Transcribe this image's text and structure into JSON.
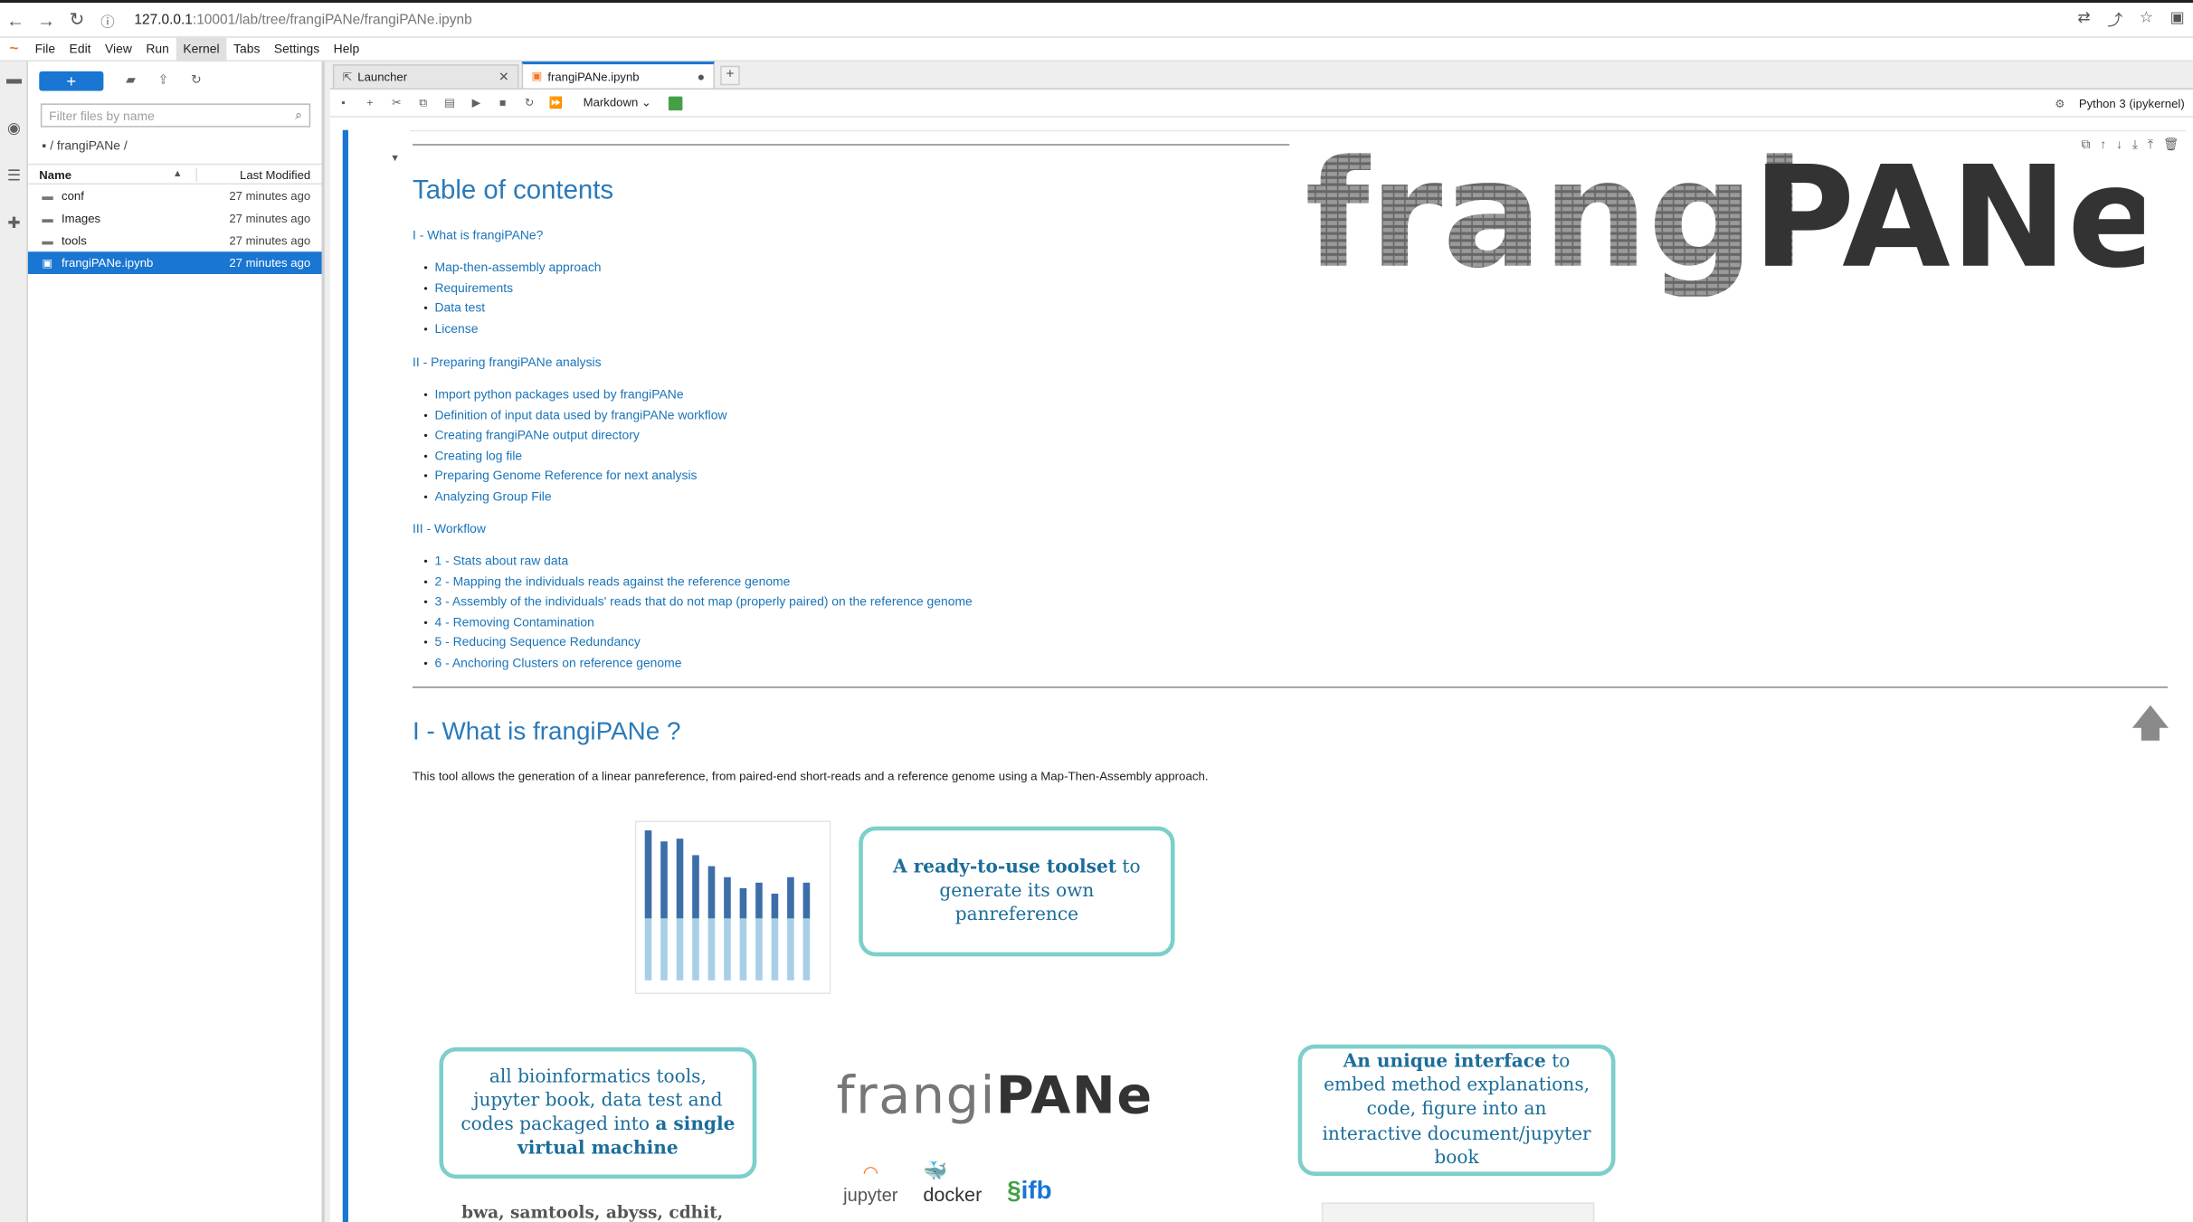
{
  "browser": {
    "url_host": "127.0.0.1",
    "url_path": ":10001/lab/tree/frangiPANe/frangiPANe.ipynb"
  },
  "menu": [
    "File",
    "Edit",
    "View",
    "Run",
    "Kernel",
    "Tabs",
    "Settings",
    "Help"
  ],
  "menu_active": "Kernel",
  "filebrowser": {
    "new_label": "+",
    "search_placeholder": "Filter files by name",
    "breadcrumb": "/ frangiPANe /",
    "col_name": "Name",
    "col_modified": "Last Modified",
    "files": [
      {
        "name": "conf",
        "modified": "27 minutes ago",
        "type": "folder"
      },
      {
        "name": "Images",
        "modified": "27 minutes ago",
        "type": "folder"
      },
      {
        "name": "tools",
        "modified": "27 minutes ago",
        "type": "folder"
      },
      {
        "name": "frangiPANe.ipynb",
        "modified": "27 minutes ago",
        "type": "notebook",
        "selected": true
      }
    ]
  },
  "tabs": [
    {
      "label": "Launcher",
      "active": false
    },
    {
      "label": "frangiPANe.ipynb",
      "active": true
    }
  ],
  "toolbar": {
    "cell_type": "Markdown",
    "kernel": "Python 3 (ipykernel)"
  },
  "notebook": {
    "toc_title": "Table of contents",
    "sections": [
      {
        "title": "I - What is frangiPANe?",
        "items": [
          "Map-then-assembly approach",
          "Requirements",
          "Data test",
          "License"
        ]
      },
      {
        "title": "II - Preparing frangiPANe analysis",
        "items": [
          "Import python packages used by frangiPANe",
          "Definition of input data used by frangiPANe workflow",
          "Creating frangiPANe output directory",
          "Creating log file",
          "Preparing Genome Reference for next analysis",
          "Analyzing Group File"
        ]
      },
      {
        "title": "III - Workflow",
        "items": [
          "1 - Stats about raw data",
          "2 - Mapping the individuals reads against the reference genome",
          "3 - Assembly of the individuals' reads that do not map (properly paired) on the reference genome",
          "4 - Removing Contamination",
          "5 - Reducing Sequence Redundancy",
          "6 - Anchoring Clusters on reference genome"
        ]
      }
    ],
    "heading": "I - What is frangiPANe ?",
    "paragraph": "This tool allows the generation of a linear panreference, from paired-end short-reads and a reference genome using a Map-Then-Assembly approach.",
    "logo_text_left": "frangi",
    "logo_text_right": "PANe",
    "box1": {
      "bold": "A ready-to-use toolset",
      "rest": " to generate its own panreference"
    },
    "box2": {
      "text": "all bioinformatics tools, jupyter book, data test and codes packaged into ",
      "bold": "a single virtual machine"
    },
    "box3": {
      "bold": "An unique interface",
      "rest": " to embed method explanations, code, figure into an interactive document/jupyter book"
    },
    "tools_list": "bwa, samtools, abyss, cdhit,",
    "logos": {
      "jupyter": "jupyter",
      "docker": "docker",
      "ifb": "ifb"
    }
  },
  "colors": {
    "accent": "#1976d2",
    "link": "#1a74b8",
    "box_border": "#7ccfcb"
  }
}
